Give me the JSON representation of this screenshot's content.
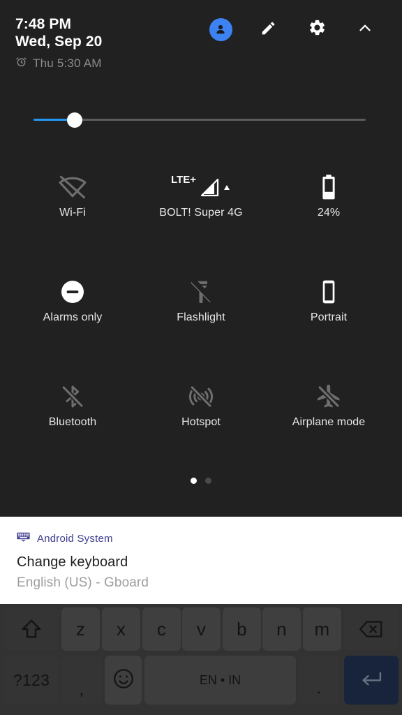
{
  "status": {
    "time": "7:48 PM",
    "date": "Wed, Sep 20",
    "alarm": "Thu 5:30 AM",
    "alarm_icon": "alarm-clock-icon"
  },
  "header_actions": [
    {
      "name": "user-avatar",
      "icon": "person-icon",
      "color": "#3d82f2"
    },
    {
      "name": "edit",
      "icon": "pencil-icon"
    },
    {
      "name": "settings",
      "icon": "gear-icon"
    },
    {
      "name": "collapse",
      "icon": "chevron-up-icon"
    }
  ],
  "brightness": {
    "label": "Brightness",
    "value": 12,
    "fill_color": "#2196f3",
    "track_color": "#5a5a5a"
  },
  "tiles": [
    {
      "label": "Wi-Fi",
      "icon": "wifi-off-icon",
      "state": "off"
    },
    {
      "label": "BOLT! Super 4G",
      "icon": "signal-cellular-icon",
      "state": "on",
      "badge": "LTE+"
    },
    {
      "label": "24%",
      "icon": "battery-icon",
      "state": "on"
    },
    {
      "label": "Alarms only",
      "icon": "do-not-disturb-icon",
      "state": "on"
    },
    {
      "label": "Flashlight",
      "icon": "flashlight-off-icon",
      "state": "off"
    },
    {
      "label": "Portrait",
      "icon": "screen-rotation-lock-icon",
      "state": "on"
    },
    {
      "label": "Bluetooth",
      "icon": "bluetooth-off-icon",
      "state": "off"
    },
    {
      "label": "Hotspot",
      "icon": "hotspot-off-icon",
      "state": "off"
    },
    {
      "label": "Airplane mode",
      "icon": "airplane-off-icon",
      "state": "off"
    }
  ],
  "pages": {
    "count": 2,
    "active": 1
  },
  "notification": {
    "app_name": "Android System",
    "app_icon": "keyboard-icon",
    "app_color": "#3f3d8f",
    "title": "Change keyboard",
    "subtitle": "English (US) - Gboard"
  },
  "keyboard": {
    "letters_row": [
      {
        "label": "",
        "name": "shift-key",
        "icon": "shift-arrow-icon"
      },
      {
        "label": "z",
        "name": "key-z"
      },
      {
        "label": "x",
        "name": "key-x"
      },
      {
        "label": "c",
        "name": "key-c"
      },
      {
        "label": "v",
        "name": "key-v"
      },
      {
        "label": "b",
        "name": "key-b"
      },
      {
        "label": "n",
        "name": "key-n"
      },
      {
        "label": "m",
        "name": "key-m"
      },
      {
        "label": "",
        "name": "backspace-key",
        "icon": "backspace-icon"
      }
    ],
    "bottom_row": {
      "symbols": "?123",
      "comma": ",",
      "emoji_icon": "emoji-smiley-icon",
      "space": "EN • IN",
      "period": ".",
      "enter_icon": "enter-return-icon",
      "enter_color": "#233557"
    }
  }
}
